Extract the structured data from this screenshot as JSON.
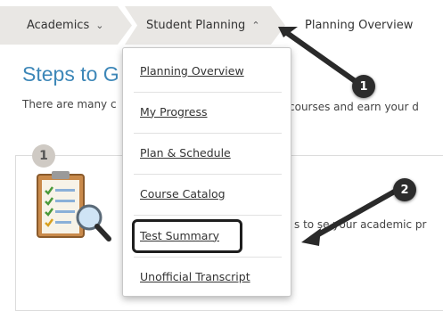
{
  "breadcrumb": {
    "academics": "Academics",
    "student_planning": "Student Planning",
    "planning_overview": "Planning Overview"
  },
  "page": {
    "heading": "Steps to G",
    "subtext": "There are many c",
    "subtext_right": "courses and earn your d"
  },
  "card": {
    "step_number": "1",
    "text_fragment": "s to se your academic pr"
  },
  "menu": {
    "items": [
      {
        "label": "Planning Overview"
      },
      {
        "label": "My Progress"
      },
      {
        "label": "Plan & Schedule"
      },
      {
        "label": "Course Catalog"
      },
      {
        "label": "Test Summary"
      },
      {
        "label": "Unofficial Transcript"
      }
    ]
  },
  "annotations": {
    "callout_1": "1",
    "callout_2": "2"
  },
  "colors": {
    "heading": "#3d87b8",
    "crumb_bg": "#e9e7e4",
    "callout_bg": "#2c2c2c"
  }
}
